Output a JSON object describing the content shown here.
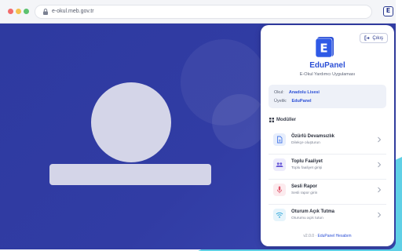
{
  "browser": {
    "url": "e-okul.meb.gov.tr",
    "extension_letter": "E"
  },
  "panel": {
    "logout_label": "Çıkış",
    "logo_letter": "E",
    "app_title": "EduPanel",
    "app_subtitle": "E-Okul Yardımcı Uygulaması",
    "info": {
      "school_label": "Okul:",
      "school_value": "Anadolu Lisesi",
      "membership_label": "Üyelik:",
      "membership_value": "EduPanel"
    },
    "modules_heading": "Modüller",
    "modules": [
      {
        "title": "Özürlü Devamsızlık",
        "subtitle": "Dilekçe oluşturun",
        "icon": "document-icon",
        "color": "#4a7be8"
      },
      {
        "title": "Toplu Faaliyet",
        "subtitle": "Toplu faaliyet girişi",
        "icon": "people-icon",
        "color": "#6a5ad8"
      },
      {
        "title": "Sesli Rapor",
        "subtitle": "Sesli rapor girin",
        "icon": "microphone-icon",
        "color": "#e0566a"
      },
      {
        "title": "Oturum Açık Tutma",
        "subtitle": "Oturumu açık tutun",
        "icon": "wifi-icon",
        "color": "#2fa6d8"
      }
    ],
    "footer": {
      "version": "v2.0.0 ·",
      "link": "EduPanel Hesabım"
    }
  },
  "colors": {
    "brand": "#2b4fd6",
    "page_background": "#2f3a9c",
    "accent_corner": "#5fd0e6"
  }
}
